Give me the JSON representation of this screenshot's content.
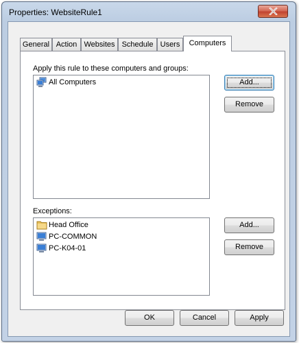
{
  "window": {
    "title": "Properties: WebsiteRule1",
    "close_icon": "close-icon"
  },
  "tabs": [
    {
      "label": "General",
      "active": false
    },
    {
      "label": "Action",
      "active": false
    },
    {
      "label": "Websites",
      "active": false
    },
    {
      "label": "Schedule",
      "active": false
    },
    {
      "label": "Users",
      "active": false
    },
    {
      "label": "Computers",
      "active": true
    }
  ],
  "apply_section": {
    "label": "Apply this rule to these computers and groups:",
    "items": [
      {
        "icon": "computers-group-icon",
        "label": "All Computers"
      }
    ],
    "add_label": "Add...",
    "remove_label": "Remove"
  },
  "exceptions_section": {
    "label": "Exceptions:",
    "items": [
      {
        "icon": "folder-icon",
        "label": "Head Office"
      },
      {
        "icon": "computer-icon",
        "label": "PC-COMMON"
      },
      {
        "icon": "computer-icon",
        "label": "PC-K04-01"
      }
    ],
    "add_label": "Add...",
    "remove_label": "Remove"
  },
  "footer": {
    "ok_label": "OK",
    "cancel_label": "Cancel",
    "apply_label": "Apply"
  }
}
